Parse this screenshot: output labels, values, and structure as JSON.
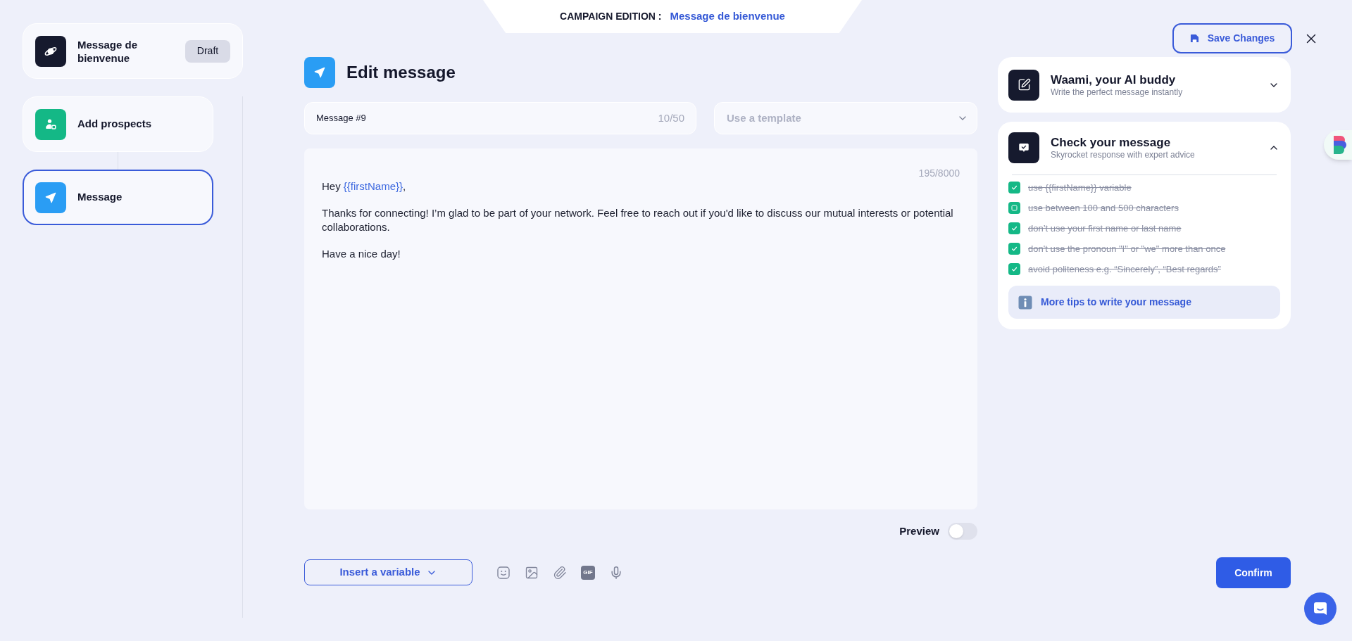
{
  "header_tab": {
    "label": "CAMPAIGN EDITION :",
    "campaign_name": "Message de bienvenue"
  },
  "campaign": {
    "name": "Message de bienvenue",
    "status": "Draft"
  },
  "steps": [
    {
      "kind": "prospects",
      "label": "Add prospects",
      "selected": false
    },
    {
      "kind": "message",
      "label": "Message",
      "selected": true
    }
  ],
  "editor": {
    "title": "Edit message",
    "name_field": {
      "value": "Message #9",
      "counter": "10/50"
    },
    "template_select": {
      "placeholder": "Use a template"
    },
    "body": {
      "counter": "195/8000",
      "paragraphs": [
        [
          {
            "text": "Hey "
          },
          {
            "text": "{{firstName}}",
            "kind": "variable"
          },
          {
            "text": ","
          }
        ],
        [
          {
            "text": "Thanks for connecting! I’m glad to be part of your network. Feel free to reach out if you'd like to discuss our mutual interests or potential collaborations."
          }
        ],
        [
          {
            "text": "Have a nice day!"
          }
        ]
      ]
    },
    "preview": {
      "label": "Preview",
      "on": false
    }
  },
  "toolbar": {
    "insert_variable": "Insert a variable",
    "gif": "GIF"
  },
  "actions": {
    "save": "Save Changes",
    "confirm": "Confirm"
  },
  "assistant": {
    "title": "Waami, your AI buddy",
    "subtitle": "Write the perfect message instantly",
    "expanded": false
  },
  "checker": {
    "title": "Check your message",
    "subtitle": "Skyrocket response with expert advice",
    "expanded": true,
    "rules": [
      {
        "text": "use {{firstName}} variable",
        "checked": true,
        "kind": "tick"
      },
      {
        "text": "use between 100 and 500 characters",
        "checked": true,
        "kind": "box"
      },
      {
        "text": "don’t use your first name or last name",
        "checked": true,
        "kind": "tick"
      },
      {
        "text": "don't use the pronoun \"I\" or \"we\" more than once",
        "checked": true,
        "kind": "tick"
      },
      {
        "text": "avoid politeness e.g. “Sincerely”, “Best regards”",
        "checked": true,
        "kind": "tick"
      }
    ],
    "tips_link": "More tips to write your message"
  }
}
